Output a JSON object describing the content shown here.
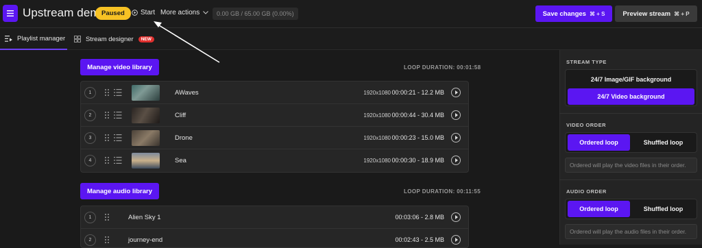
{
  "header": {
    "title": "Upstream demo",
    "status_badge": "Paused",
    "start_label": "Start",
    "more_actions_label": "More actions",
    "storage_text": "0.00 GB / 65.00 GB (0.00%)",
    "save_label": "Save changes",
    "save_shortcut": "⌘ + S",
    "preview_label": "Preview stream",
    "preview_shortcut": "⌘ + P"
  },
  "tabs": [
    {
      "label": "Playlist manager",
      "active": true
    },
    {
      "label": "Stream designer",
      "badge": "NEW",
      "active": false
    }
  ],
  "video_section": {
    "button_label": "Manage video library",
    "loop_duration": "LOOP DURATION: 00:01:58",
    "items": [
      {
        "num": "1",
        "name": "AWaves",
        "res": "1920x1080",
        "info": "00:00:21 - 12.2 MB"
      },
      {
        "num": "2",
        "name": "Cliff",
        "res": "1920x1080",
        "info": "00:00:44 - 30.4 MB"
      },
      {
        "num": "3",
        "name": "Drone",
        "res": "1920x1080",
        "info": "00:00:23 - 15.0 MB"
      },
      {
        "num": "4",
        "name": "Sea",
        "res": "1920x1080",
        "info": "00:00:30 - 18.9 MB"
      }
    ]
  },
  "audio_section": {
    "button_label": "Manage audio library",
    "loop_duration": "LOOP DURATION: 00:11:55",
    "items": [
      {
        "num": "1",
        "name": "Alien Sky 1",
        "info": "00:03:06 - 2.8 MB"
      },
      {
        "num": "2",
        "name": "journey-end",
        "info": "00:02:43 - 2.5 MB"
      }
    ]
  },
  "sidebar": {
    "stream_type_label": "STREAM TYPE",
    "stream_type_options": [
      "24/7 Image/GIF background",
      "24/7 Video background"
    ],
    "video_order_label": "VIDEO ORDER",
    "video_order_options": [
      "Ordered loop",
      "Shuffled loop"
    ],
    "video_order_note": "Ordered will play the video files in their order.",
    "audio_order_label": "AUDIO ORDER",
    "audio_order_options": [
      "Ordered loop",
      "Shuffled loop"
    ],
    "audio_order_note": "Ordered will play the audio files in their order."
  },
  "colors": {
    "accent": "#5b16f2",
    "paused_badge": "#f7c224",
    "new_badge": "#e0302e"
  }
}
